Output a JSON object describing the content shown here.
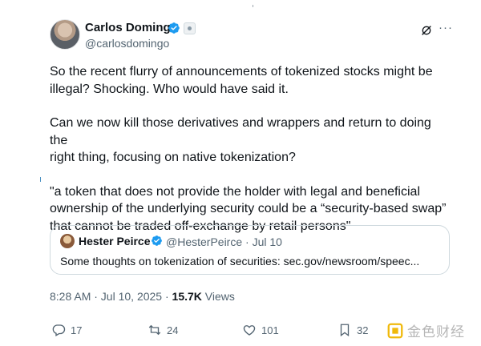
{
  "author": {
    "name": "Carlos Domingo",
    "handle": "@carlosdomingo"
  },
  "post": {
    "paragraphs": [
      "So the recent flurry of announcements of tokenized stocks might be\nillegal? Shocking. Who would have said it.",
      "Can we now kill those derivatives and wrappers and return to doing the\nright thing, focusing on native tokenization?",
      "\"a token that does not provide the holder with legal and beneficial\nownership of the underlying security could be a “security-based swap”\nthat cannot be traded off-exchange by retail persons\""
    ]
  },
  "quote": {
    "name": "Hester Peirce",
    "handle_date": "@HesterPeirce · Jul 10",
    "text": "Some thoughts on tokenization of securities: sec.gov/newsroom/speec..."
  },
  "meta": {
    "timestamp": "8:28 AM · Jul 10, 2025 · ",
    "views_count": "15.7K",
    "views_label": " Views"
  },
  "actions": {
    "replies": "17",
    "reposts": "24",
    "likes": "101",
    "bookmarks": "32"
  },
  "watermark": {
    "text": "金色财经"
  },
  "colors": {
    "verified": "#1d9bf0",
    "secondary_text": "#536471",
    "primary_text": "#0f1419",
    "watermark_logo": "#f0b90b"
  }
}
